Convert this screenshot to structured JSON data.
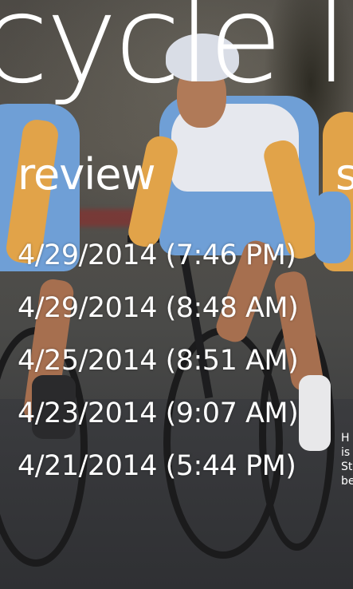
{
  "app": {
    "title": "cycle log"
  },
  "pivot": {
    "headers": [
      {
        "label": "review"
      },
      {
        "label": "s"
      }
    ]
  },
  "logs": [
    {
      "label": "4/29/2014 (7:46 PM)"
    },
    {
      "label": "4/29/2014 (8:48 AM)"
    },
    {
      "label": "4/25/2014 (8:51 AM)"
    },
    {
      "label": "4/23/2014 (9:07 AM)"
    },
    {
      "label": "4/21/2014 (5:44 PM)"
    }
  ],
  "peek": {
    "lines": [
      "H",
      "is",
      "St",
      "be"
    ]
  },
  "colors": {
    "text": "#ffffff",
    "jersey_blue": "#6f9fd6",
    "jersey_orange": "#e1a349",
    "background_dark": "#3a3b3d"
  }
}
